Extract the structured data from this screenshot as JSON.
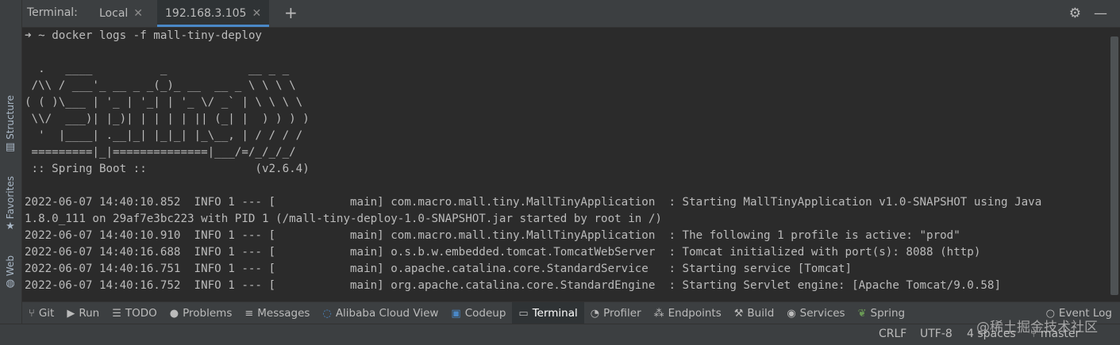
{
  "left_sidebar": {
    "structure_label": "Structure",
    "favorites_label": "Favorites",
    "web_label": "Web"
  },
  "tabbar": {
    "label": "Terminal:",
    "tabs": [
      {
        "label": "Local"
      },
      {
        "label": "192.168.3.105"
      }
    ],
    "new_tab": "+",
    "settings_icon": "⚙",
    "minimize_icon": "—"
  },
  "terminal": {
    "prompt_symbol": "➜",
    "prompt_dir": "~",
    "command": "docker logs -f mall-tiny-deploy",
    "banner": "  .   ____          _            __ _ _\n /\\\\ / ___'_ __ _ _(_)_ __  __ _ \\ \\ \\ \\\n( ( )\\___ | '_ | '_| | '_ \\/ _` | \\ \\ \\ \\\n \\\\/  ___)| |_)| | | | | || (_| |  ) ) ) )\n  '  |____| .__|_| |_|_| |_\\__, | / / / /\n =========|_|==============|___/=/_/_/_/\n :: Spring Boot ::                (v2.6.4)",
    "log_lines": [
      "2022-06-07 14:40:10.852  INFO 1 --- [           main] com.macro.mall.tiny.MallTinyApplication  : Starting MallTinyApplication v1.0-SNAPSHOT using Java",
      "1.8.0_111 on 29af7e3bc223 with PID 1 (/mall-tiny-deploy-1.0-SNAPSHOT.jar started by root in /)",
      "2022-06-07 14:40:10.910  INFO 1 --- [           main] com.macro.mall.tiny.MallTinyApplication  : The following 1 profile is active: \"prod\"",
      "2022-06-07 14:40:16.688  INFO 1 --- [           main] o.s.b.w.embedded.tomcat.TomcatWebServer  : Tomcat initialized with port(s): 8088 (http)",
      "2022-06-07 14:40:16.751  INFO 1 --- [           main] o.apache.catalina.core.StandardService   : Starting service [Tomcat]",
      "2022-06-07 14:40:16.752  INFO 1 --- [           main] org.apache.catalina.core.StandardEngine  : Starting Servlet engine: [Apache Tomcat/9.0.58]"
    ]
  },
  "bottom_tools": [
    {
      "label": "Git",
      "icon": "git-icon"
    },
    {
      "label": "Run",
      "icon": "run-icon"
    },
    {
      "label": "TODO",
      "icon": "todo-icon"
    },
    {
      "label": "Problems",
      "icon": "problems-icon"
    },
    {
      "label": "Messages",
      "icon": "messages-icon"
    },
    {
      "label": "Alibaba Cloud View",
      "icon": "alibaba-cloud-icon"
    },
    {
      "label": "Codeup",
      "icon": "codeup-icon"
    },
    {
      "label": "Terminal",
      "icon": "terminal-icon",
      "active": true
    },
    {
      "label": "Profiler",
      "icon": "profiler-icon"
    },
    {
      "label": "Endpoints",
      "icon": "endpoints-icon"
    },
    {
      "label": "Build",
      "icon": "build-icon"
    },
    {
      "label": "Services",
      "icon": "services-icon"
    },
    {
      "label": "Spring",
      "icon": "spring-icon"
    },
    {
      "label": "Event Log",
      "icon": "event-log-icon"
    }
  ],
  "status": {
    "line_sep": "CRLF",
    "encoding": "UTF-8",
    "indent": "4 spaces",
    "branch": "master"
  },
  "watermark": "@稀土掘金技术社区",
  "colors": {
    "background": "#2b2b2b",
    "panel": "#3c3f41",
    "active_tab_underline": "#4a88c7",
    "text": "#bbbbbb"
  }
}
